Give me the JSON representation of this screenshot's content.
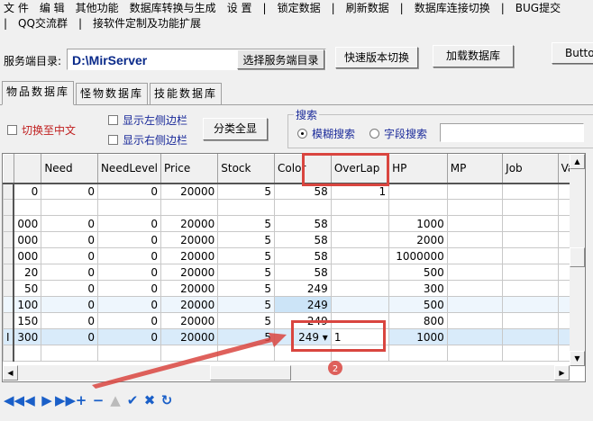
{
  "menu": {
    "row1": [
      "文 件",
      "编 辑",
      "其他功能",
      "数据库转换与生成",
      "设 置",
      "|",
      "锁定数据",
      "|",
      "刷新数据",
      "|",
      "数据库连接切换",
      "|",
      "BUG提交"
    ],
    "row2": [
      "|",
      "QQ交流群",
      "|",
      "接软件定制及功能扩展"
    ]
  },
  "toolbar": {
    "dir_label": "服务端目录:",
    "dir_value": "D:\\MirServer",
    "choose_dir": "选择服务端目录",
    "quick_switch": "快速版本切换",
    "load_db": "加载数据库",
    "button": "Button"
  },
  "tabs": [
    "物品数据库",
    "怪物数据库",
    "技能数据库"
  ],
  "options": {
    "switch_cn": "切换至中文",
    "show_left": "显示左侧边栏",
    "show_right": "显示右侧边栏",
    "show_all": "分类全显",
    "search_group": "搜索",
    "fuzzy": "模糊搜索",
    "field": "字段搜索",
    "search_value": ""
  },
  "grid": {
    "columns": [
      "",
      "Need",
      "NeedLevel",
      "Price",
      "Stock",
      "Color",
      "OverLap",
      "HP",
      "MP",
      "Job",
      "Va"
    ],
    "rows": [
      [
        "0",
        "0",
        "0",
        "20000",
        "5",
        "58",
        "1",
        "",
        "",
        "",
        ""
      ],
      [
        "",
        "",
        "",
        "",
        "",
        "",
        "",
        "",
        "",
        "",
        ""
      ],
      [
        "000",
        "0",
        "0",
        "20000",
        "5",
        "58",
        "",
        "1000",
        "",
        "",
        ""
      ],
      [
        "000",
        "0",
        "0",
        "20000",
        "5",
        "58",
        "",
        "2000",
        "",
        "",
        ""
      ],
      [
        "000",
        "0",
        "0",
        "20000",
        "5",
        "58",
        "",
        "1000000",
        "",
        "",
        ""
      ],
      [
        "20",
        "0",
        "0",
        "20000",
        "5",
        "58",
        "",
        "500",
        "",
        "",
        ""
      ],
      [
        "50",
        "0",
        "0",
        "20000",
        "5",
        "249",
        "",
        "300",
        "",
        "",
        ""
      ],
      [
        "100",
        "0",
        "0",
        "20000",
        "5",
        "249",
        "",
        "500",
        "",
        "",
        ""
      ],
      [
        "150",
        "0",
        "0",
        "20000",
        "5",
        "249",
        "",
        "800",
        "",
        "",
        ""
      ],
      [
        "300",
        "0",
        "0",
        "20000",
        "5",
        "249 ▾",
        "1",
        "1000",
        "",
        "",
        ""
      ],
      [
        "",
        "",
        "",
        "",
        "",
        "",
        "",
        "",
        "",
        "",
        ""
      ]
    ],
    "editing_value": "1"
  },
  "nav": [
    "first-icon",
    "prior-icon",
    "next-icon",
    "last-icon",
    "insert-icon",
    "delete-icon",
    "edit-icon",
    "post-icon",
    "cancel-icon",
    "refresh-icon"
  ],
  "nav_glyphs": [
    "◀◀",
    "◀",
    "▶",
    "▶▶",
    "+",
    "−",
    "▲",
    "✔",
    "✖",
    "↻"
  ],
  "annotation_label": "2",
  "colors": {
    "annotation": "#d9453f",
    "nav": "#1a5fc8",
    "selected_row": "#d9ebfa"
  }
}
